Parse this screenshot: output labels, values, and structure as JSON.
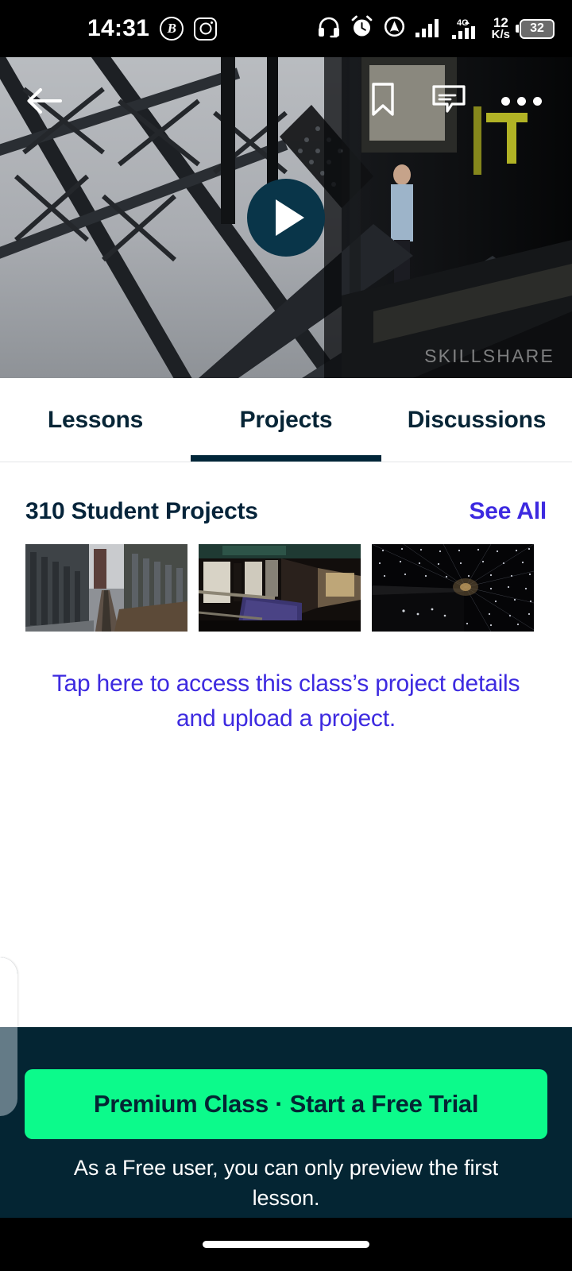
{
  "status_bar": {
    "time": "14:31",
    "left_icons": [
      {
        "name": "bitcoin-circle-icon",
        "glyph": "B"
      },
      {
        "name": "instagram-icon",
        "glyph": ""
      }
    ],
    "right_icons": [
      {
        "name": "headset-icon"
      },
      {
        "name": "alarm-clock-icon"
      },
      {
        "name": "location-radar-icon"
      },
      {
        "name": "signal-bars-icon"
      },
      {
        "name": "signal-4g-icon"
      }
    ],
    "network_type": "4G",
    "data_rate_value": "12",
    "data_rate_unit": "K/s",
    "battery_percent": "32"
  },
  "hero": {
    "back_label": "Back",
    "bookmark_label": "Save",
    "comments_label": "Comments",
    "more_label": "More options",
    "play_label": "Play",
    "watermark": "SKILLSHARE"
  },
  "tabs": [
    {
      "label": "Lessons",
      "active": false
    },
    {
      "label": "Projects",
      "active": true
    },
    {
      "label": "Discussions",
      "active": false
    }
  ],
  "projects": {
    "section_title": "310 Student Projects",
    "see_all_label": "See All",
    "thumbnails": [
      {
        "alt": "elevated-train-tracks-between-city-buildings"
      },
      {
        "alt": "subway-car-interior"
      },
      {
        "alt": "dark-tunnel-with-light-dots"
      }
    ],
    "tap_prompt": "Tap here to access this class’s project details and upload a project."
  },
  "footer": {
    "cta_label": "Premium Class · Start a Free Trial",
    "note": "As a Free user, you can only preview the first lesson."
  },
  "colors": {
    "accent_purple": "#3d2ae0",
    "accent_green": "#0cfa8b",
    "navy": "#042533",
    "tab_active": "#002639",
    "play_circle": "#093549"
  }
}
